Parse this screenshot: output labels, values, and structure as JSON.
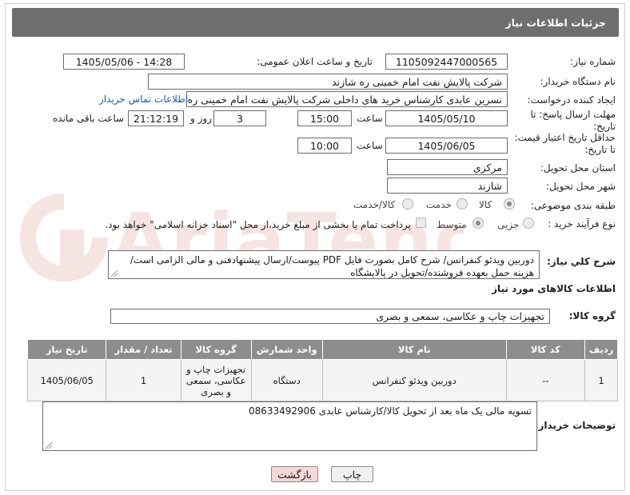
{
  "header": {
    "title": "جزئیات اطلاعات نیاز"
  },
  "form": {
    "need_number_label": "شماره نیاز:",
    "need_number": "1105092447000565",
    "announce_label": "تاریخ و ساعت اعلان عمومی:",
    "announce_value": "1405/05/06 - 14:28",
    "buyer_org_label": "نام دستگاه خریدار:",
    "buyer_org": "شرکت پالایش نفت امام خمینی  ره  شازند",
    "requester_label": "ایجاد کننده درخواست:",
    "requester": "نسرین عابدی کارشناس خرید های داخلی  شرکت پالایش نفت امام خمینی  ره  شازند",
    "buyer_contact_link": "اطلاعات تماس خریدار",
    "deadline_label_1": "مهلت ارسال پاسخ: تا",
    "deadline_label_2": "تاریخ:",
    "deadline_date": "1405/05/10",
    "time_label": "ساعت",
    "deadline_time": "15:00",
    "days_value": "3",
    "days_label": "روز و",
    "remaining_value": "21:12:19",
    "remaining_label": "ساعت باقی مانده",
    "validity_label_1": "حداقل تاریخ اعتبار قیمت:",
    "validity_label_2": "تا تاریخ:",
    "validity_date": "1405/06/05",
    "validity_time": "10:00",
    "province_label": "استان محل تحویل:",
    "province": "مرکزی",
    "city_label": "شهر محل تحویل:",
    "city": "شازند",
    "category_label": "طبقه بندی موضوعی:",
    "category_options": [
      "کالا",
      "خدمت",
      "کالا/خدمت"
    ],
    "category_selected": "کالا",
    "process_label": "نوع فرآیند خرید :",
    "process_options": [
      "جزیی",
      "متوسط"
    ],
    "process_selected": "متوسط",
    "payment_note": "پرداخت تمام یا بخشی از مبلغ خرید،از محل \"اسناد خزانه اسلامی\" خواهد بود."
  },
  "description": {
    "label": "شرح كلي نياز:",
    "text": "دوربین ویدئو کنفرانس/ شرح کامل بصورت فایل PDF پیوست/ارسال پیشنهادفنی و مالی الزامی است/هزینه حمل بعهده فروشنده/تحویل در پالایشگاه"
  },
  "goods": {
    "section_title": "اطلاعات کالاهای مورد نیاز",
    "group_label": "گروه کالا:",
    "group_value": "تجهیزات چاپ و عکاسی، سمعی و بصری",
    "columns": [
      "ردیف",
      "کد کالا",
      "نام کالا",
      "واحد شمارش",
      "گروه کالا",
      "تعداد / مقدار",
      "تاریخ نیاز"
    ],
    "rows": [
      [
        "1",
        "--",
        "دوربین ویدئو کنفرانس",
        "دستگاه",
        "تجهیزات چاپ و عکاسی، سمعی و بصری",
        "1",
        "1405/06/05"
      ]
    ]
  },
  "buyer_notes": {
    "label": "توضیحات خریدار:",
    "text": "تسویه مالی یک ماه بعد از تحویل کالا/کارشناس عابدی 08633492906"
  },
  "buttons": {
    "print": "چاپ",
    "back": "بازگشت"
  },
  "watermark_text": "AriaTender.net",
  "colors": {
    "header_bg": "#6e6e6e",
    "table_header_bg": "#8d8d8d",
    "link": "#1a5ca8",
    "back_button_bg": "#f7d7d7",
    "watermark": "#c0392b"
  }
}
